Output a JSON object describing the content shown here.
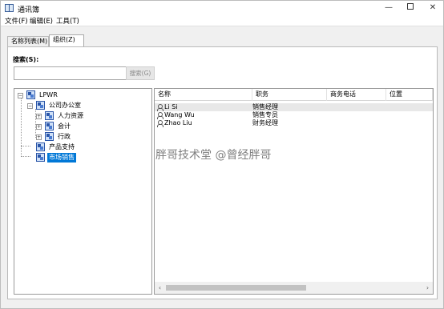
{
  "window": {
    "title": "通讯簿"
  },
  "menubar": {
    "items": [
      "文件(F)",
      "编辑(E)",
      "工具(T)"
    ]
  },
  "tabs": [
    "名称列表(M)",
    "组织(Z)"
  ],
  "search": {
    "label": "搜索(S):",
    "value": "",
    "button_label": "搜索(G)"
  },
  "tree": {
    "root": "LPWR",
    "office": "公司办公室",
    "hr": "人力资源",
    "accounting": "会计",
    "admin": "行政",
    "product_support": "产品支持",
    "marketing": "市场销售"
  },
  "columns": [
    "名称",
    "职务",
    "商务电话",
    "位置"
  ],
  "rows": [
    {
      "name": "Li Si",
      "title": "销售经理"
    },
    {
      "name": "Wang Wu",
      "title": "销售专员"
    },
    {
      "name": "Zhao Liu",
      "title": "财务经理"
    }
  ],
  "watermark": "胖哥技术堂 @曾经胖哥",
  "icons": {
    "app": "address-book-icon",
    "org": "org-icon",
    "person": "person-icon"
  }
}
